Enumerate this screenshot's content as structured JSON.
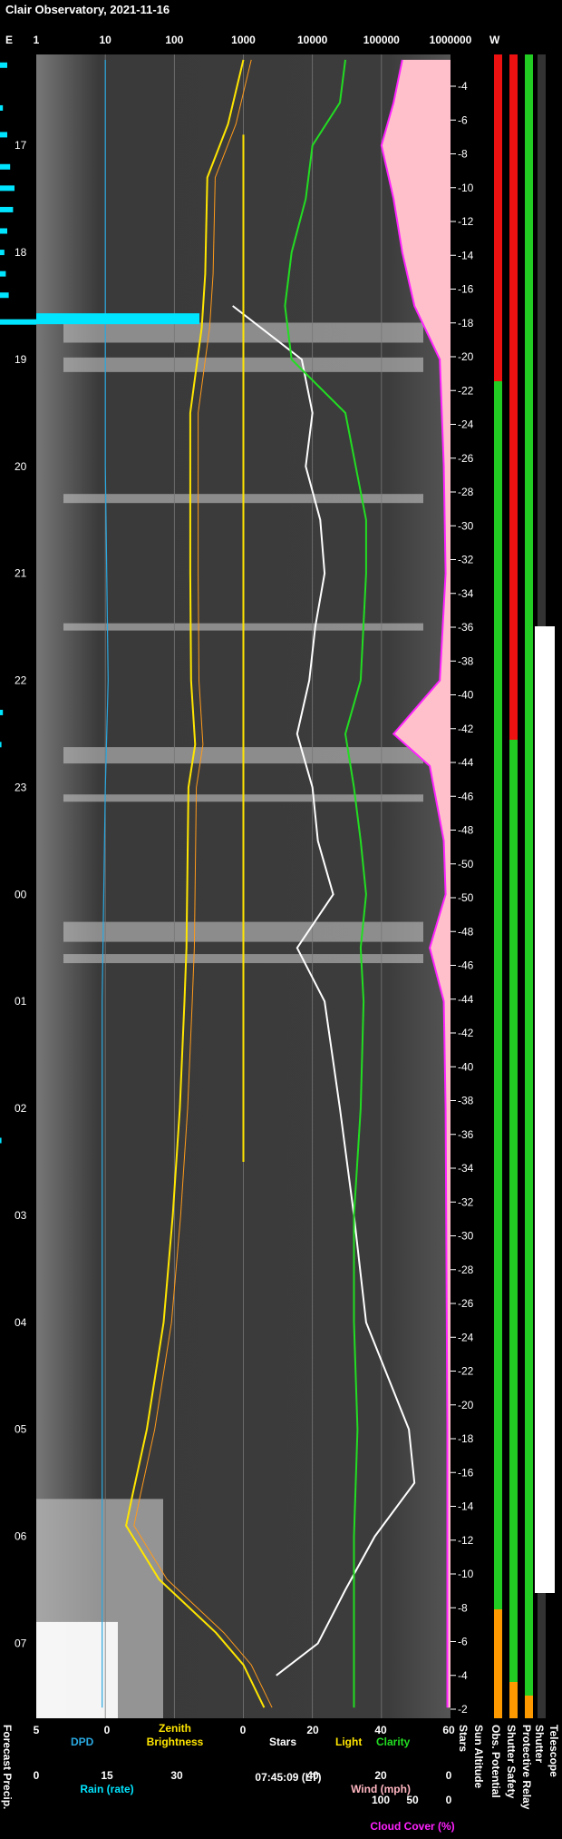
{
  "title": "Clair Observatory, 2021-11-16",
  "colors": {
    "background": "#000000",
    "dpd": "#2aa8e0",
    "rain": "#00e5ff",
    "zenith": "#ffe600",
    "zenith_model": "#ff9a1a",
    "stars": "#ffffff",
    "clarity": "#22dd22",
    "cloud": "#ff22ff",
    "cloud_fill": "#ffc0cb",
    "red": "#ee1111",
    "green": "#22cc22",
    "orange": "#ff9900",
    "yellow": "#ffe600"
  },
  "top_axis": {
    "east": "E",
    "west": "W",
    "ticks": [
      "1",
      "10",
      "100",
      "1000",
      "10000",
      "100000",
      "1000000"
    ]
  },
  "bottom_axes": {
    "row1": [
      "5",
      "0",
      "0",
      "20",
      "40",
      "60"
    ],
    "row2": [
      "0",
      "15",
      "30",
      "40",
      "20",
      "0"
    ],
    "row3": [
      "100",
      "50",
      "0"
    ],
    "time": "07:45:09 (LT)",
    "labels": {
      "forecast": "Forecast Precip.",
      "dpd": "DPD",
      "zenith": "Zenith Brightness",
      "stars": "Stars",
      "light": "Light",
      "clarity": "Clarity",
      "rain": "Rain (rate)",
      "wind": "Wind (mph)",
      "cloud": "Cloud Cover (%)",
      "stars_v": "Stars",
      "sun_alt": "Sun Altitude",
      "obs_pot": "Obs. Potential",
      "shutter_safety": "Shutter Safety",
      "protective": "Protective Relay",
      "shutter": "Shutter",
      "telescope": "Telescope"
    }
  },
  "chart_data": {
    "type": "line",
    "x_scale": "log",
    "xlim": [
      1,
      1000000
    ],
    "time_labels": [
      "17",
      "18",
      "19",
      "20",
      "21",
      "22",
      "23",
      "00",
      "01",
      "02",
      "03",
      "04",
      "05",
      "06",
      "07"
    ],
    "sun_altitude_labels": [
      "-4",
      "-6",
      "-8",
      "-10",
      "-12",
      "-14",
      "-16",
      "-18",
      "-20",
      "-22",
      "-24",
      "-26",
      "-28",
      "-30",
      "-32",
      "-34",
      "-36",
      "-38",
      "-40",
      "-42",
      "-44",
      "-46",
      "-48",
      "-50",
      "-50",
      "-48",
      "-46",
      "-44",
      "-42",
      "-40",
      "-38",
      "-36",
      "-34",
      "-32",
      "-30",
      "-28",
      "-26",
      "-24",
      "-22",
      "-20",
      "-18",
      "-16",
      "-14",
      "-12",
      "-10",
      "-8",
      "-6",
      "-4",
      "-2"
    ],
    "series": [
      {
        "name": "Zenith Brightness",
        "points": [
          [
            16.2,
            1000
          ],
          [
            16.8,
            600
          ],
          [
            17.3,
            300
          ],
          [
            18.2,
            280
          ],
          [
            18.7,
            250
          ],
          [
            19.5,
            170
          ],
          [
            21,
            170
          ],
          [
            22,
            175
          ],
          [
            22.6,
            200
          ],
          [
            23,
            160
          ],
          [
            0.5,
            150
          ],
          [
            1,
            140
          ],
          [
            2,
            120
          ],
          [
            3,
            95
          ],
          [
            4,
            70
          ],
          [
            5,
            40
          ],
          [
            5.6,
            25
          ],
          [
            5.9,
            20
          ],
          [
            6.4,
            60
          ],
          [
            6.9,
            400
          ],
          [
            7.2,
            1000
          ],
          [
            7.6,
            2000
          ]
        ]
      },
      {
        "name": "Stars",
        "points": [
          [
            18.5,
            700
          ],
          [
            19,
            7000
          ],
          [
            19.5,
            10000
          ],
          [
            20,
            8000
          ],
          [
            20.5,
            13000
          ],
          [
            21,
            15000
          ],
          [
            21.5,
            11000
          ],
          [
            22,
            9000
          ],
          [
            22.5,
            6000
          ],
          [
            23,
            10000
          ],
          [
            23.5,
            12000
          ],
          [
            0,
            20000
          ],
          [
            0.5,
            6000
          ],
          [
            1,
            15000
          ],
          [
            2,
            25000
          ],
          [
            3,
            40000
          ],
          [
            4,
            60000
          ],
          [
            5,
            250000
          ],
          [
            5.5,
            300000
          ],
          [
            6,
            80000
          ],
          [
            6.5,
            30000
          ],
          [
            7,
            12000
          ],
          [
            7.3,
            3000
          ]
        ]
      },
      {
        "name": "Clarity",
        "points": [
          [
            16.2,
            30000
          ],
          [
            16.6,
            25000
          ],
          [
            17,
            10000
          ],
          [
            17.5,
            8000
          ],
          [
            18,
            5000
          ],
          [
            18.5,
            4000
          ],
          [
            19,
            5000
          ],
          [
            19.5,
            30000
          ],
          [
            20.5,
            60000
          ],
          [
            21,
            60000
          ],
          [
            22,
            50000
          ],
          [
            22.5,
            30000
          ],
          [
            23,
            40000
          ],
          [
            23.5,
            50000
          ],
          [
            0,
            60000
          ],
          [
            0.5,
            50000
          ],
          [
            1,
            55000
          ],
          [
            2,
            50000
          ],
          [
            3,
            40000
          ],
          [
            4,
            40000
          ],
          [
            5,
            45000
          ],
          [
            6,
            40000
          ],
          [
            7,
            40000
          ],
          [
            7.6,
            40000
          ]
        ]
      },
      {
        "name": "Cloud Cover",
        "points": [
          [
            16.2,
            200000
          ],
          [
            16.6,
            150000
          ],
          [
            17,
            100000
          ],
          [
            17.5,
            150000
          ],
          [
            18,
            200000
          ],
          [
            18.5,
            300000
          ],
          [
            19,
            700000
          ],
          [
            20,
            800000
          ],
          [
            21,
            850000
          ],
          [
            22,
            700000
          ],
          [
            22.5,
            150000
          ],
          [
            22.8,
            500000
          ],
          [
            23.5,
            800000
          ],
          [
            0,
            850000
          ],
          [
            0.5,
            500000
          ],
          [
            1,
            800000
          ],
          [
            2,
            850000
          ],
          [
            5,
            900000
          ],
          [
            7.6,
            900000
          ]
        ]
      },
      {
        "name": "DPD",
        "points": [
          [
            16.2,
            10
          ],
          [
            18,
            10
          ],
          [
            20,
            10
          ],
          [
            22,
            11
          ],
          [
            23,
            10
          ],
          [
            1,
            9
          ],
          [
            3,
            9
          ],
          [
            5,
            9
          ],
          [
            7.6,
            9
          ]
        ]
      }
    ],
    "rain_rate": [
      [
        16.25,
        5
      ],
      [
        16.65,
        2
      ],
      [
        16.9,
        5
      ],
      [
        17.2,
        7
      ],
      [
        17.4,
        10
      ],
      [
        17.6,
        9
      ],
      [
        17.8,
        5
      ],
      [
        18.0,
        3
      ],
      [
        18.2,
        4
      ],
      [
        18.4,
        6
      ],
      [
        18.65,
        25
      ],
      [
        22.3,
        2
      ],
      [
        22.6,
        1
      ],
      [
        2.3,
        1
      ]
    ]
  }
}
